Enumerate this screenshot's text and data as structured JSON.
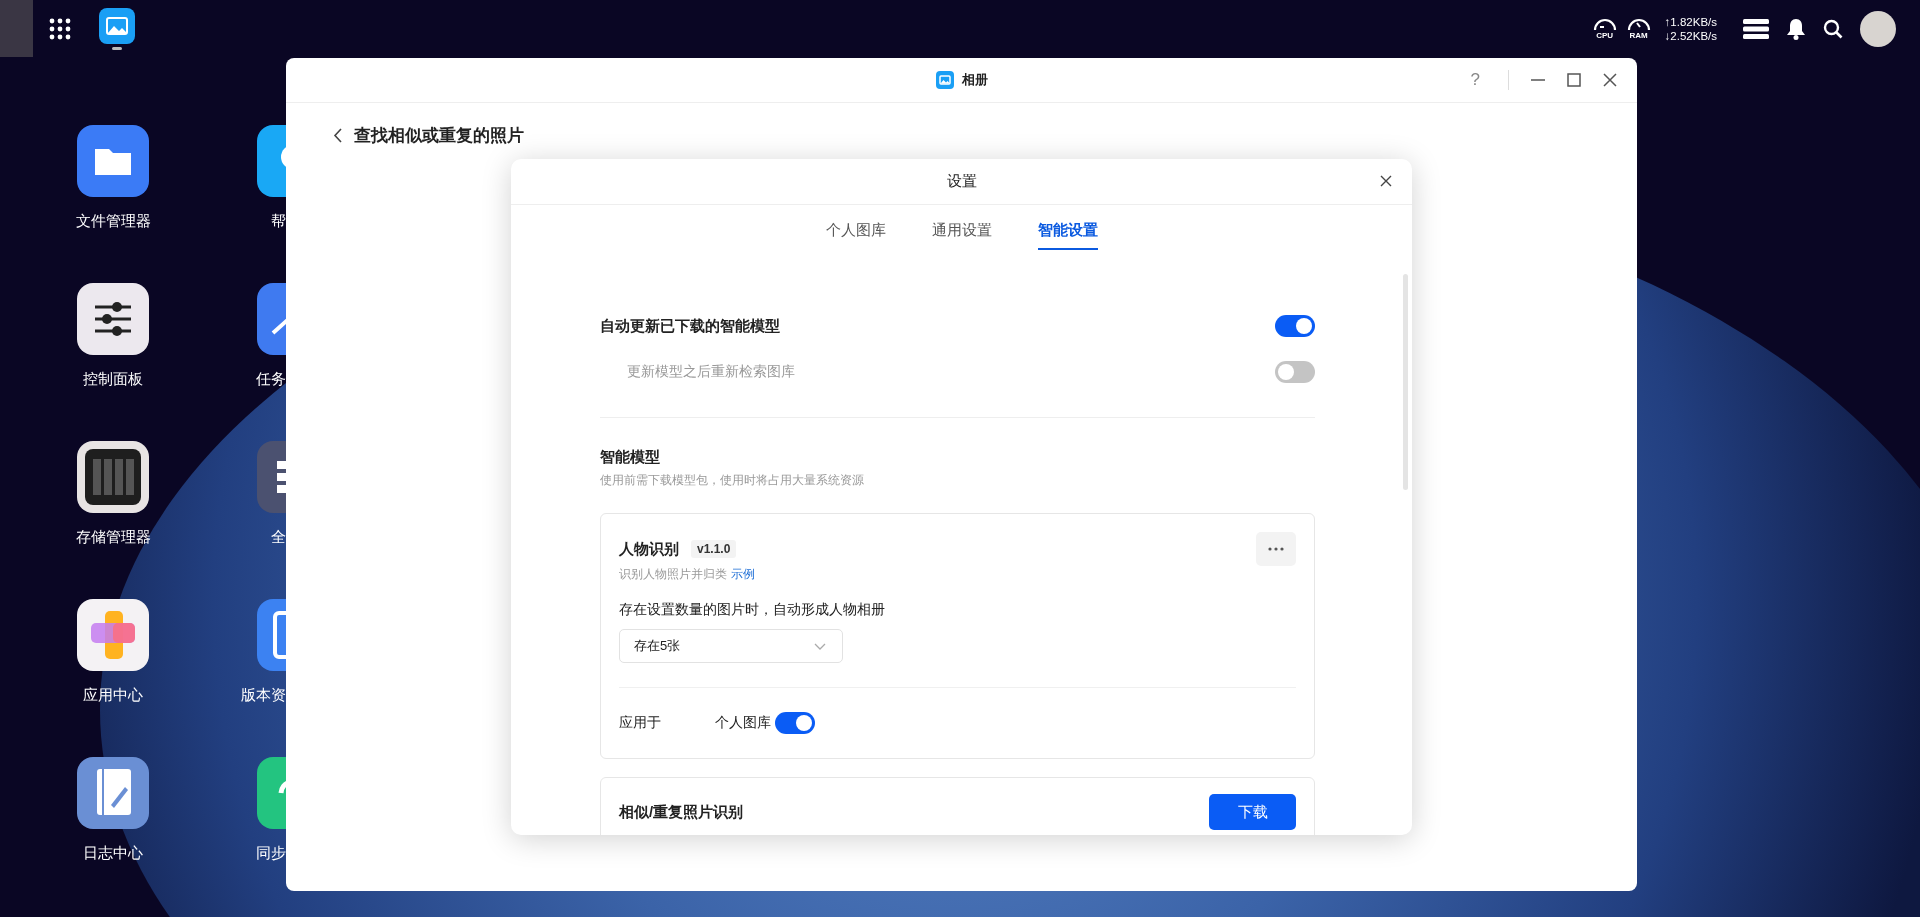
{
  "taskbar": {
    "cpu_label": "CPU",
    "ram_label": "RAM",
    "upload": "↑1.82KB/s",
    "download": "↓2.52KB/s"
  },
  "desktop_icons": [
    {
      "label": "文件管理器",
      "kind": "files"
    },
    {
      "label": "帮",
      "kind": "help"
    },
    {
      "label": "控制面板",
      "kind": "control"
    },
    {
      "label": "任务",
      "kind": "task"
    },
    {
      "label": "存储管理器",
      "kind": "storage"
    },
    {
      "label": "全",
      "kind": "global"
    },
    {
      "label": "应用中心",
      "kind": "appcenter"
    },
    {
      "label": "版本资",
      "kind": "version"
    },
    {
      "label": "日志中心",
      "kind": "log"
    },
    {
      "label": "同步",
      "kind": "sync"
    }
  ],
  "window": {
    "title": "相册",
    "help": "?",
    "page_title": "查找相似或重复的照片"
  },
  "dialog": {
    "title": "设置",
    "tabs": [
      {
        "label": "个人图库",
        "selected": false
      },
      {
        "label": "通用设置",
        "selected": false
      },
      {
        "label": "智能设置",
        "selected": true
      }
    ],
    "settings": [
      {
        "kind": "main",
        "label": "自动更新已下载的智能模型",
        "on": true,
        "disabled": false
      },
      {
        "kind": "sub",
        "label": "更新模型之后重新检索图库",
        "on": false,
        "disabled": true
      }
    ],
    "section": {
      "title": "智能模型",
      "description": "使用前需下载模型包，使用时将占用大量系统资源"
    },
    "models": [
      {
        "kind": "installed",
        "name": "人物识别",
        "version": "v1.1.0",
        "description": "识别人物照片并归类",
        "link": "示例",
        "threshold_label": "存在设置数量的图片时，自动形成人物相册",
        "threshold_value": "存在5张",
        "apply_label": "应用于",
        "apply_target": "个人图库",
        "apply_on": true
      },
      {
        "kind": "available",
        "name": "相似/重复照片识别",
        "action": "下载"
      }
    ]
  }
}
